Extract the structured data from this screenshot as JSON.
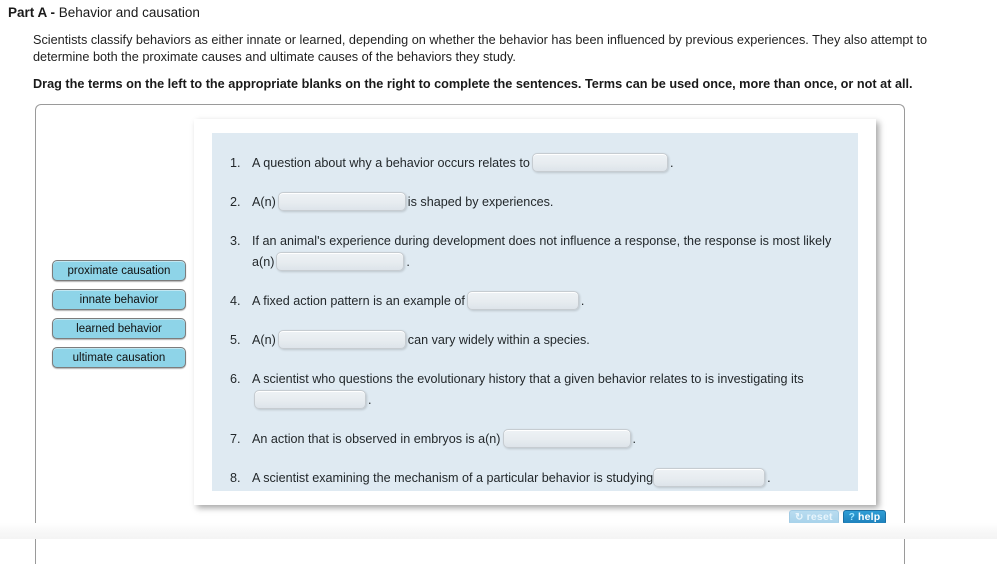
{
  "header": {
    "part_label": "Part A",
    "dash": " - ",
    "part_subject": "Behavior and causation",
    "intro": "Scientists classify behaviors as either innate or learned, depending on whether the behavior has been influenced by previous experiences. They also attempt to determine both the proximate causes and ultimate causes of the behaviors they study.",
    "instruction": "Drag the terms on the left to the appropriate blanks on the right to complete the sentences. Terms can be used once, more than once, or not at all."
  },
  "terms": [
    {
      "label": "proximate causation"
    },
    {
      "label": "innate behavior"
    },
    {
      "label": "learned behavior"
    },
    {
      "label": "ultimate causation"
    }
  ],
  "questions": [
    {
      "number": "1.",
      "before": "A question about why a behavior occurs relates to",
      "blank_value": "",
      "after": "."
    },
    {
      "number": "2.",
      "before": "A(n)",
      "blank_value": "",
      "after": "is shaped by experiences."
    },
    {
      "number": "3.",
      "before": "If an animal's experience during development does not influence a response, the response is most likely a(n)",
      "blank_value": "",
      "after": "."
    },
    {
      "number": "4.",
      "before": "A fixed action pattern is an example of",
      "blank_value": "",
      "after": "."
    },
    {
      "number": "5.",
      "before": "A(n)",
      "blank_value": "",
      "after": "can vary widely within a species."
    },
    {
      "number": "6.",
      "before": "A scientist who questions the evolutionary history that a given behavior relates to is investigating its",
      "blank_value": "",
      "after": "."
    },
    {
      "number": "7.",
      "before": "An action that is observed in embryos is a(n)",
      "blank_value": "",
      "after": "."
    },
    {
      "number": "8.",
      "before": "A scientist examining the mechanism of a particular behavior is studying",
      "blank_value": "",
      "after": "."
    }
  ],
  "buttons": {
    "reset_label": "reset",
    "reset_icon": "refresh-icon",
    "reset_glyph": "↻",
    "help_label": "help",
    "help_icon": "question-mark-icon",
    "help_glyph": "?"
  },
  "colors": {
    "term_tile": "#8ed4e8",
    "question_area": "#dfeaf2",
    "help_button": "#1d7fba",
    "reset_button": "#a7d2ea",
    "panel_border": "#9a9a9a"
  }
}
